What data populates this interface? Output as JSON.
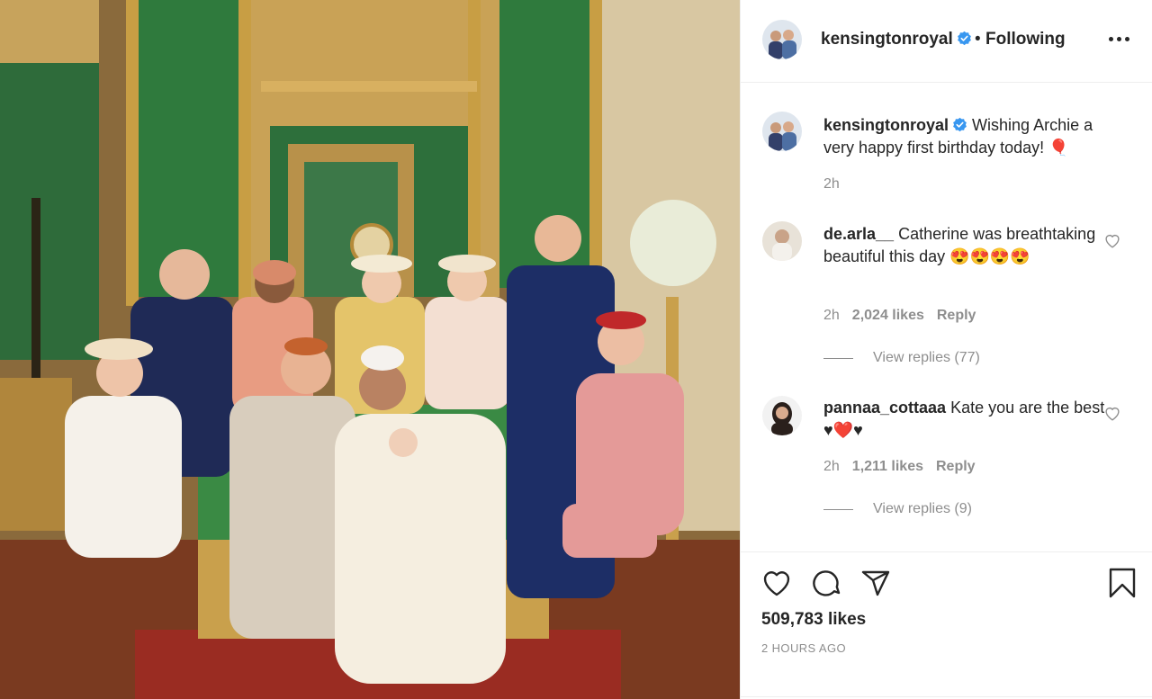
{
  "post": {
    "username": "kensingtonroyal",
    "separator": "•",
    "follow_status": "Following",
    "more_icon": "more-options-icon",
    "caption": {
      "username": "kensingtonroyal",
      "text": "Wishing Archie a very happy first birthday today! 🎈",
      "time": "2h"
    },
    "comments": [
      {
        "username": "de.arla__",
        "text": "Catherine was breathtaking beautiful this day 😍😍😍😍",
        "time": "2h",
        "likes": "2,024 likes",
        "reply_label": "Reply",
        "view_replies": "View replies (77)"
      },
      {
        "username": "pannaa_cottaaa",
        "text": "Kate you are the best ♥❤️♥",
        "time": "2h",
        "likes": "1,211 likes",
        "reply_label": "Reply",
        "view_replies": "View replies (9)"
      }
    ],
    "likes_count": "509,783 likes",
    "posted_ago": "2 HOURS AGO"
  },
  "colors": {
    "text": "#262626",
    "muted": "#8e8e8e",
    "verified_blue": "#3897f0",
    "divider": "#efefef"
  },
  "icons": [
    "verified-badge-icon",
    "like-heart-icon",
    "comment-icon",
    "share-icon",
    "bookmark-icon",
    "comment-like-icon"
  ]
}
